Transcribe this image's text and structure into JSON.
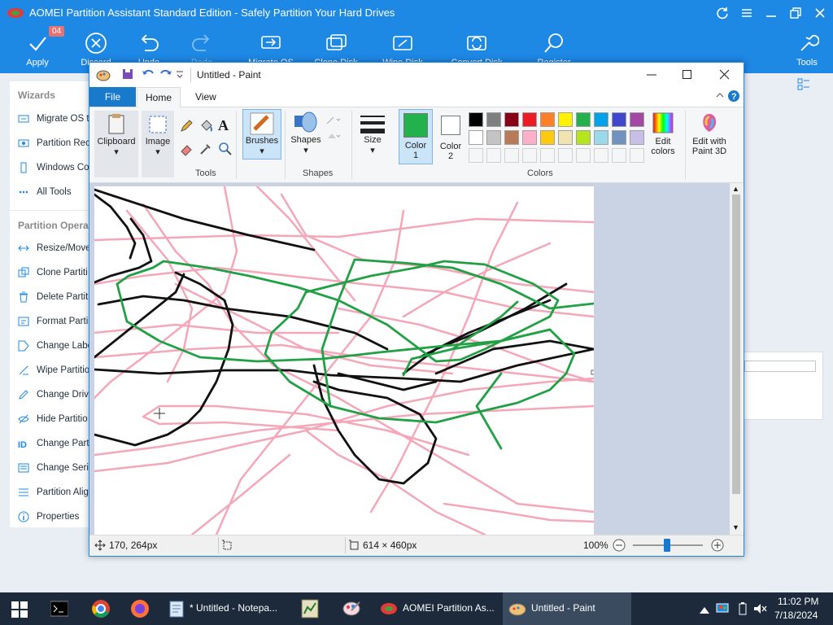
{
  "aomei": {
    "title": "AOMEI Partition Assistant Standard Edition - Safely Partition Your Hard Drives",
    "apply_badge": "04",
    "toolbar": {
      "apply": "Apply",
      "discard": "Discard",
      "undo": "Undo",
      "redo": "Redo",
      "migrate_os": "Migrate OS",
      "clone_disk": "Clone Disk",
      "wipe_disk": "Wipe Disk",
      "convert_disk": "Convert Disk",
      "register": "Register",
      "tools": "Tools"
    },
    "sidebar": {
      "wizards_heading": "Wizards",
      "wizards": [
        "Migrate OS t",
        "Partition Rec",
        "Windows Co",
        "All Tools"
      ],
      "partition_heading": "Partition Opera",
      "operations": [
        "Resize/Move",
        "Clone Partiti",
        "Delete Partit",
        "Format Parti",
        "Change Labe",
        "Wipe Partitio",
        "Change Driv",
        "Hide Partitio",
        "Change Part",
        "Change Seria",
        "Partition Alig",
        "Properties"
      ]
    }
  },
  "paint": {
    "title": "Untitled - Paint",
    "tabs": {
      "file": "File",
      "home": "Home",
      "view": "View"
    },
    "ribbon": {
      "clipboard": "Clipboard",
      "image": "Image",
      "tools_group": "Tools",
      "brushes": "Brushes",
      "shapes": "Shapes",
      "shapes_group": "Shapes",
      "size": "Size",
      "color1_line1": "Color",
      "color1_line2": "1",
      "color2_line1": "Color",
      "color2_line2": "2",
      "colors_group": "Colors",
      "edit_colors_line1": "Edit",
      "edit_colors_line2": "colors",
      "paint3d_line1": "Edit with",
      "paint3d_line2": "Paint 3D"
    },
    "colors": {
      "color1": "#22b14c",
      "color2": "#ffffff",
      "palette_row1": [
        "#000000",
        "#7f7f7f",
        "#880015",
        "#ed1c24",
        "#ff7f27",
        "#fff200",
        "#22b14c",
        "#00a2e8",
        "#3f48cc",
        "#a349a4"
      ],
      "palette_row2": [
        "#ffffff",
        "#c3c3c3",
        "#b97a57",
        "#ffaec9",
        "#ffc90e",
        "#efe4b0",
        "#b5e61d",
        "#99d9ea",
        "#7092be",
        "#c8bfe7"
      ]
    },
    "status": {
      "cursor_pos": "170, 264px",
      "canvas_size": "614 × 460px",
      "zoom": "100%"
    }
  },
  "taskbar": {
    "notepad": "* Untitled - Notepa...",
    "aomei": "AOMEI Partition As...",
    "paint": "Untitled - Paint",
    "time": "11:02 PM",
    "date": "7/18/2024"
  }
}
